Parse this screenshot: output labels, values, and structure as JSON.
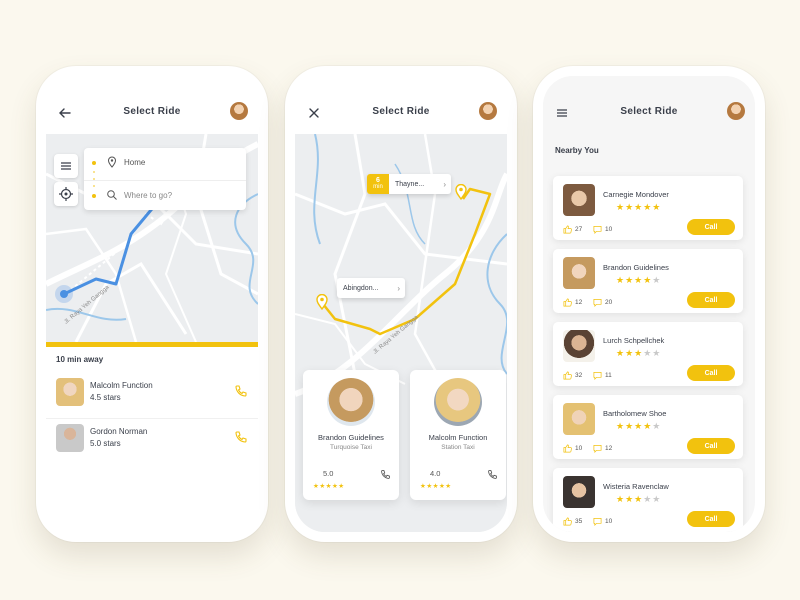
{
  "colors": {
    "accent": "#f2c20e",
    "route_blue": "#4a90e2",
    "map_bg": "#eceef0"
  },
  "screen1": {
    "title": "Select Ride",
    "back_icon": "arrow-left-icon",
    "search": {
      "from": "Home",
      "to_placeholder": "Where to go?"
    },
    "map_road_label": "Jl. Raya Yeh Gangga",
    "eta": "10 min away",
    "drivers": [
      {
        "name": "Malcolm Function",
        "rating": "4.5 stars"
      },
      {
        "name": "Gordon Norman",
        "rating": "5.0 stars"
      }
    ]
  },
  "screen2": {
    "title": "Select Ride",
    "close_icon": "close-icon",
    "tag_destination": {
      "minutes": "6",
      "unit": "min",
      "label": "Thayne..."
    },
    "tag_origin": {
      "label": "Abingdon..."
    },
    "map_road_label": "Jl. Raya Yeh Gangga",
    "cards": [
      {
        "name": "Brandon Guidelines",
        "company": "Turquoise Taxi",
        "rating": "5.0",
        "stars": "★★★★★"
      },
      {
        "name": "Malcolm Function",
        "company": "Station Taxi",
        "rating": "4.0",
        "stars": "★★★★★"
      }
    ]
  },
  "screen3": {
    "title": "Select Ride",
    "menu_icon": "menu-icon",
    "section": "Nearby You",
    "call_label": "Call",
    "drivers": [
      {
        "name": "Carnegie Mondover",
        "stars_on": "★★★★★",
        "stars_off": "",
        "likes": "27",
        "comments": "10"
      },
      {
        "name": "Brandon Guidelines",
        "stars_on": "★★★★",
        "stars_off": "★",
        "likes": "12",
        "comments": "20"
      },
      {
        "name": "Lurch Schpellchek",
        "stars_on": "★★★",
        "stars_off": "★★",
        "likes": "32",
        "comments": "11"
      },
      {
        "name": "Bartholomew Shoe",
        "stars_on": "★★★★",
        "stars_off": "★",
        "likes": "10",
        "comments": "12"
      },
      {
        "name": "Wisteria Ravenclaw",
        "stars_on": "★★★",
        "stars_off": "★★",
        "likes": "35",
        "comments": "10"
      }
    ]
  }
}
